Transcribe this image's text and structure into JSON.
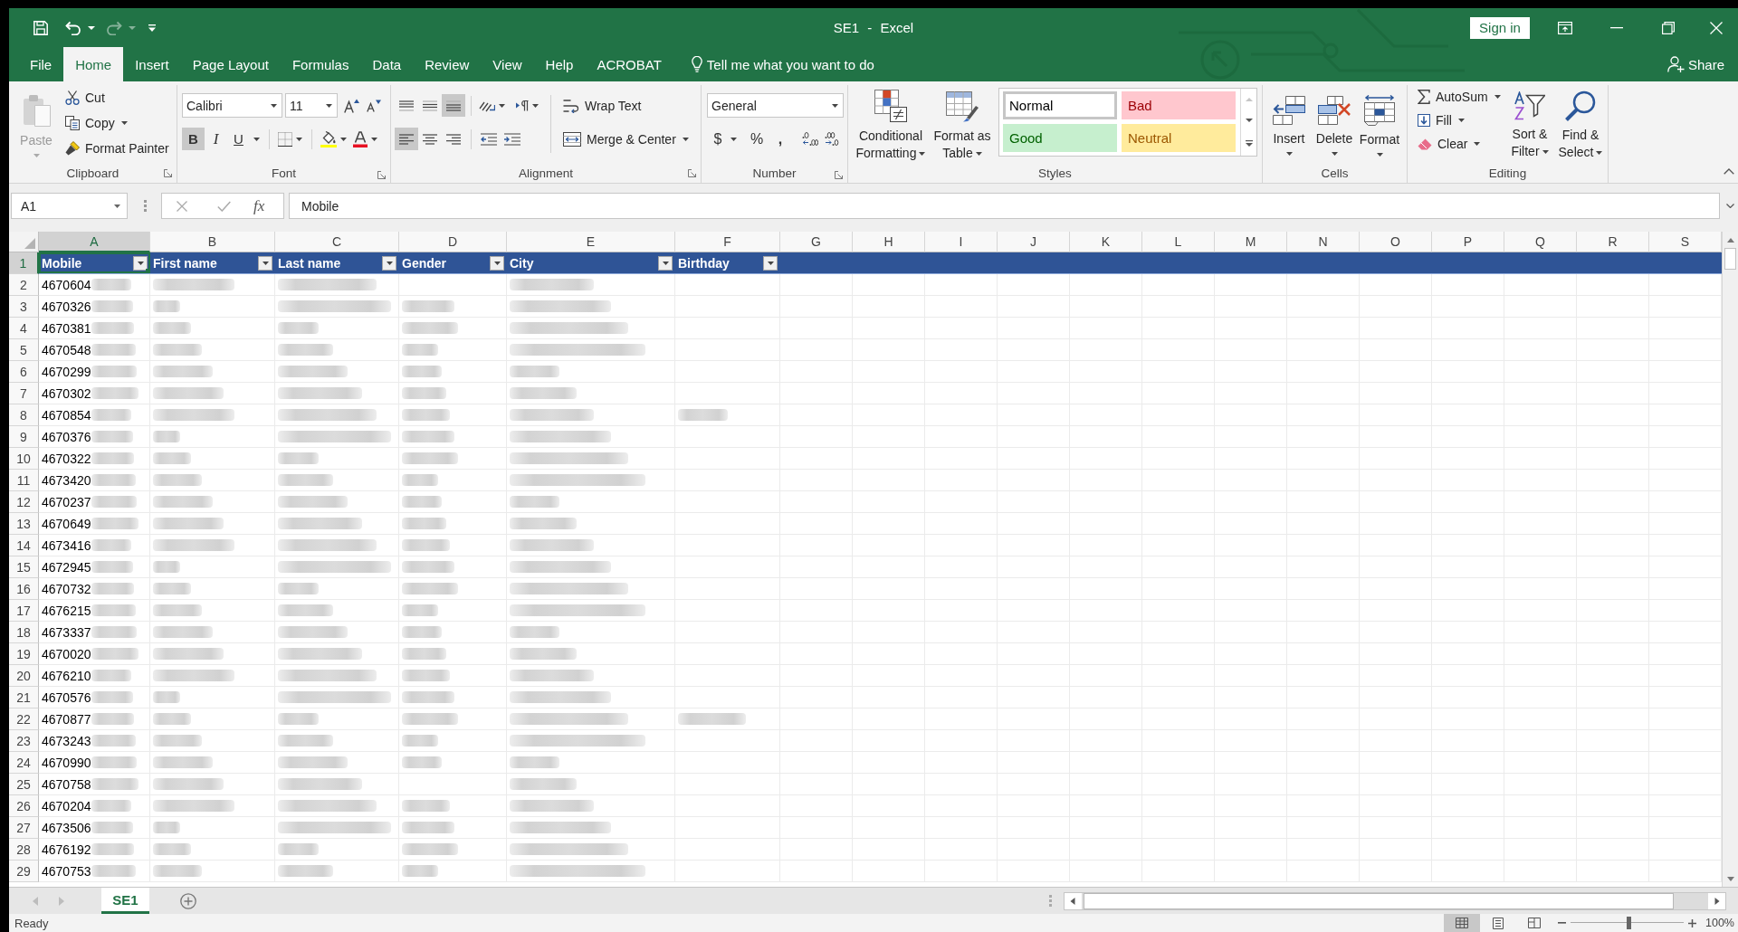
{
  "title_bar": {
    "quick_access": [
      {
        "kind": "save",
        "disabled": false
      },
      {
        "kind": "undo",
        "disabled": false
      },
      {
        "kind": "redo",
        "disabled": true
      },
      {
        "kind": "customize",
        "disabled": false
      }
    ],
    "title": "SE1 - Excel",
    "sign_in": "Sign in"
  },
  "tabs": [
    {
      "label": "File",
      "selected": false
    },
    {
      "label": "Home",
      "selected": true
    },
    {
      "label": "Insert",
      "selected": false
    },
    {
      "label": "Page Layout",
      "selected": false
    },
    {
      "label": "Formulas",
      "selected": false
    },
    {
      "label": "Data",
      "selected": false
    },
    {
      "label": "Review",
      "selected": false
    },
    {
      "label": "View",
      "selected": false
    },
    {
      "label": "Help",
      "selected": false
    },
    {
      "label": "ACROBAT",
      "selected": false
    }
  ],
  "tell_me": {
    "placeholder": "Tell me what you want to do"
  },
  "share": "Share",
  "ribbon": {
    "clipboard": {
      "label": "Clipboard",
      "paste": {
        "label": "Paste",
        "disabled": true
      },
      "cut": "Cut",
      "copy": "Copy",
      "format_painter": "Format Painter"
    },
    "font": {
      "label": "Font",
      "font_name": "Calibri",
      "font_size": "11",
      "styles": [
        {
          "kind": "bold",
          "label": "B",
          "on": true
        },
        {
          "kind": "italic",
          "label": "I",
          "on": false
        },
        {
          "kind": "underline",
          "label": "U",
          "on": false
        }
      ]
    },
    "alignment": {
      "label": "Alignment",
      "vertical": [
        {
          "kind": "top",
          "on": false
        },
        {
          "kind": "middle",
          "on": false
        },
        {
          "kind": "bottom",
          "on": true
        }
      ],
      "horizontal": [
        {
          "kind": "left",
          "on": true
        },
        {
          "kind": "center",
          "on": false
        },
        {
          "kind": "right",
          "on": false
        }
      ],
      "wrap_text": "Wrap Text",
      "merge_center": "Merge & Center"
    },
    "number": {
      "label": "Number",
      "format": "General",
      "symbols": [
        {
          "kind": "currency",
          "label": "$"
        },
        {
          "kind": "percent",
          "label": "%"
        },
        {
          "kind": "comma",
          "label": ","
        }
      ]
    },
    "styles": {
      "label": "Styles",
      "conditional_formatting": "Conditional Formatting",
      "format_as_table": "Format as Table",
      "cell_styles": [
        {
          "label": "Normal",
          "selected": true,
          "color": "#ffffff",
          "font": {
            "color": "#000000"
          }
        },
        {
          "label": "Bad",
          "selected": false,
          "color": "#ffc7ce",
          "font": {
            "color": "#9c0006"
          }
        },
        {
          "label": "Good",
          "selected": false,
          "color": "#c6efce",
          "font": {
            "color": "#006100"
          }
        },
        {
          "label": "Neutral",
          "selected": false,
          "color": "#ffeb9c",
          "font": {
            "color": "#9c5700"
          }
        }
      ]
    },
    "cells": {
      "label": "Cells",
      "buttons": [
        {
          "kind": "insert",
          "label": "Insert"
        },
        {
          "kind": "delete",
          "label": "Delete"
        },
        {
          "kind": "format",
          "label": "Format"
        }
      ]
    },
    "editing": {
      "label": "Editing",
      "autosum": "AutoSum",
      "fill": "Fill",
      "clear": "Clear",
      "sort_filter": "Sort & Filter",
      "find_select": "Find & Select"
    }
  },
  "formula_bar": {
    "name_box": "A1",
    "function_label": "fx",
    "formula": "Mobile"
  },
  "sheet": {
    "columns": [
      {
        "label": "A",
        "selected": true
      },
      {
        "label": "B",
        "selected": false
      },
      {
        "label": "C",
        "selected": false
      },
      {
        "label": "D",
        "selected": false
      },
      {
        "label": "E",
        "selected": false
      },
      {
        "label": "F",
        "selected": false
      },
      {
        "label": "G",
        "selected": false
      },
      {
        "label": "H",
        "selected": false
      },
      {
        "label": "I",
        "selected": false
      },
      {
        "label": "J",
        "selected": false
      },
      {
        "label": "K",
        "selected": false
      },
      {
        "label": "L",
        "selected": false
      },
      {
        "label": "M",
        "selected": false
      },
      {
        "label": "N",
        "selected": false
      },
      {
        "label": "O",
        "selected": false
      },
      {
        "label": "P",
        "selected": false
      },
      {
        "label": "Q",
        "selected": false
      },
      {
        "label": "R",
        "selected": false
      },
      {
        "label": "S",
        "selected": false
      }
    ],
    "header_row": {
      "number": "1",
      "selected": true,
      "cells": [
        {
          "text": "Mobile",
          "selected": true
        },
        {
          "text": "First name",
          "selected": false
        },
        {
          "text": "Last name",
          "selected": false
        },
        {
          "text": "Gender",
          "selected": false
        },
        {
          "text": "City",
          "selected": false
        },
        {
          "text": "Birthday",
          "selected": false
        }
      ]
    },
    "rows": [
      {
        "number": "2",
        "selected": false,
        "mobile": "4670604",
        "blurred": [
          true,
          true,
          true,
          false,
          true,
          false
        ]
      },
      {
        "number": "3",
        "selected": false,
        "mobile": "4670326",
        "blurred": [
          true,
          true,
          true,
          true,
          true,
          false
        ]
      },
      {
        "number": "4",
        "selected": false,
        "mobile": "4670381",
        "blurred": [
          true,
          true,
          true,
          true,
          true,
          false
        ]
      },
      {
        "number": "5",
        "selected": false,
        "mobile": "4670548",
        "blurred": [
          true,
          true,
          true,
          true,
          true,
          false
        ]
      },
      {
        "number": "6",
        "selected": false,
        "mobile": "4670299",
        "blurred": [
          true,
          true,
          true,
          true,
          true,
          false
        ]
      },
      {
        "number": "7",
        "selected": false,
        "mobile": "4670302",
        "blurred": [
          true,
          true,
          true,
          true,
          true,
          false
        ]
      },
      {
        "number": "8",
        "selected": false,
        "mobile": "4670854",
        "blurred": [
          true,
          true,
          true,
          true,
          true,
          true
        ]
      },
      {
        "number": "9",
        "selected": false,
        "mobile": "4670376",
        "blurred": [
          true,
          true,
          true,
          true,
          true,
          false
        ]
      },
      {
        "number": "10",
        "selected": false,
        "mobile": "4670322",
        "blurred": [
          true,
          true,
          true,
          true,
          true,
          false
        ]
      },
      {
        "number": "11",
        "selected": false,
        "mobile": "4673420",
        "blurred": [
          true,
          true,
          true,
          true,
          true,
          false
        ]
      },
      {
        "number": "12",
        "selected": false,
        "mobile": "4670237",
        "blurred": [
          true,
          true,
          true,
          true,
          true,
          false
        ]
      },
      {
        "number": "13",
        "selected": false,
        "mobile": "4670649",
        "blurred": [
          true,
          true,
          true,
          true,
          true,
          false
        ]
      },
      {
        "number": "14",
        "selected": false,
        "mobile": "4673416",
        "blurred": [
          true,
          true,
          true,
          true,
          true,
          false
        ]
      },
      {
        "number": "15",
        "selected": false,
        "mobile": "4672945",
        "blurred": [
          true,
          true,
          true,
          true,
          true,
          false
        ]
      },
      {
        "number": "16",
        "selected": false,
        "mobile": "4670732",
        "blurred": [
          true,
          true,
          true,
          true,
          true,
          false
        ]
      },
      {
        "number": "17",
        "selected": false,
        "mobile": "4676215",
        "blurred": [
          true,
          true,
          true,
          true,
          true,
          false
        ]
      },
      {
        "number": "18",
        "selected": false,
        "mobile": "4673337",
        "blurred": [
          true,
          true,
          true,
          true,
          true,
          false
        ]
      },
      {
        "number": "19",
        "selected": false,
        "mobile": "4670020",
        "blurred": [
          true,
          true,
          true,
          true,
          true,
          false
        ]
      },
      {
        "number": "20",
        "selected": false,
        "mobile": "4676210",
        "blurred": [
          true,
          true,
          true,
          true,
          true,
          false
        ]
      },
      {
        "number": "21",
        "selected": false,
        "mobile": "4670576",
        "blurred": [
          true,
          true,
          true,
          true,
          true,
          false
        ]
      },
      {
        "number": "22",
        "selected": false,
        "mobile": "4670877",
        "blurred": [
          true,
          true,
          true,
          true,
          true,
          true
        ]
      },
      {
        "number": "23",
        "selected": false,
        "mobile": "4673243",
        "blurred": [
          true,
          true,
          true,
          true,
          true,
          false
        ]
      },
      {
        "number": "24",
        "selected": false,
        "mobile": "4670990",
        "blurred": [
          true,
          true,
          true,
          true,
          true,
          false
        ]
      },
      {
        "number": "25",
        "selected": false,
        "mobile": "4670758",
        "blurred": [
          true,
          true,
          true,
          false,
          true,
          false
        ]
      },
      {
        "number": "26",
        "selected": false,
        "mobile": "4670204",
        "blurred": [
          true,
          true,
          true,
          true,
          true,
          false
        ]
      },
      {
        "number": "27",
        "selected": false,
        "mobile": "4673506",
        "blurred": [
          true,
          true,
          true,
          true,
          true,
          false
        ]
      },
      {
        "number": "28",
        "selected": false,
        "mobile": "4676192",
        "blurred": [
          true,
          true,
          true,
          true,
          true,
          false
        ]
      },
      {
        "number": "29",
        "selected": false,
        "mobile": "4670753",
        "blurred": [
          true,
          true,
          true,
          true,
          true,
          false
        ]
      }
    ]
  },
  "sheet_tabs": [
    {
      "label": "SE1",
      "selected": true
    }
  ],
  "status_bar": {
    "status": "Ready",
    "views": [
      {
        "kind": "normal",
        "selected": true
      },
      {
        "kind": "page_layout",
        "selected": false
      },
      {
        "kind": "page_break",
        "selected": false
      }
    ],
    "zoom": {
      "level": 0.51,
      "reading": "100%"
    }
  }
}
